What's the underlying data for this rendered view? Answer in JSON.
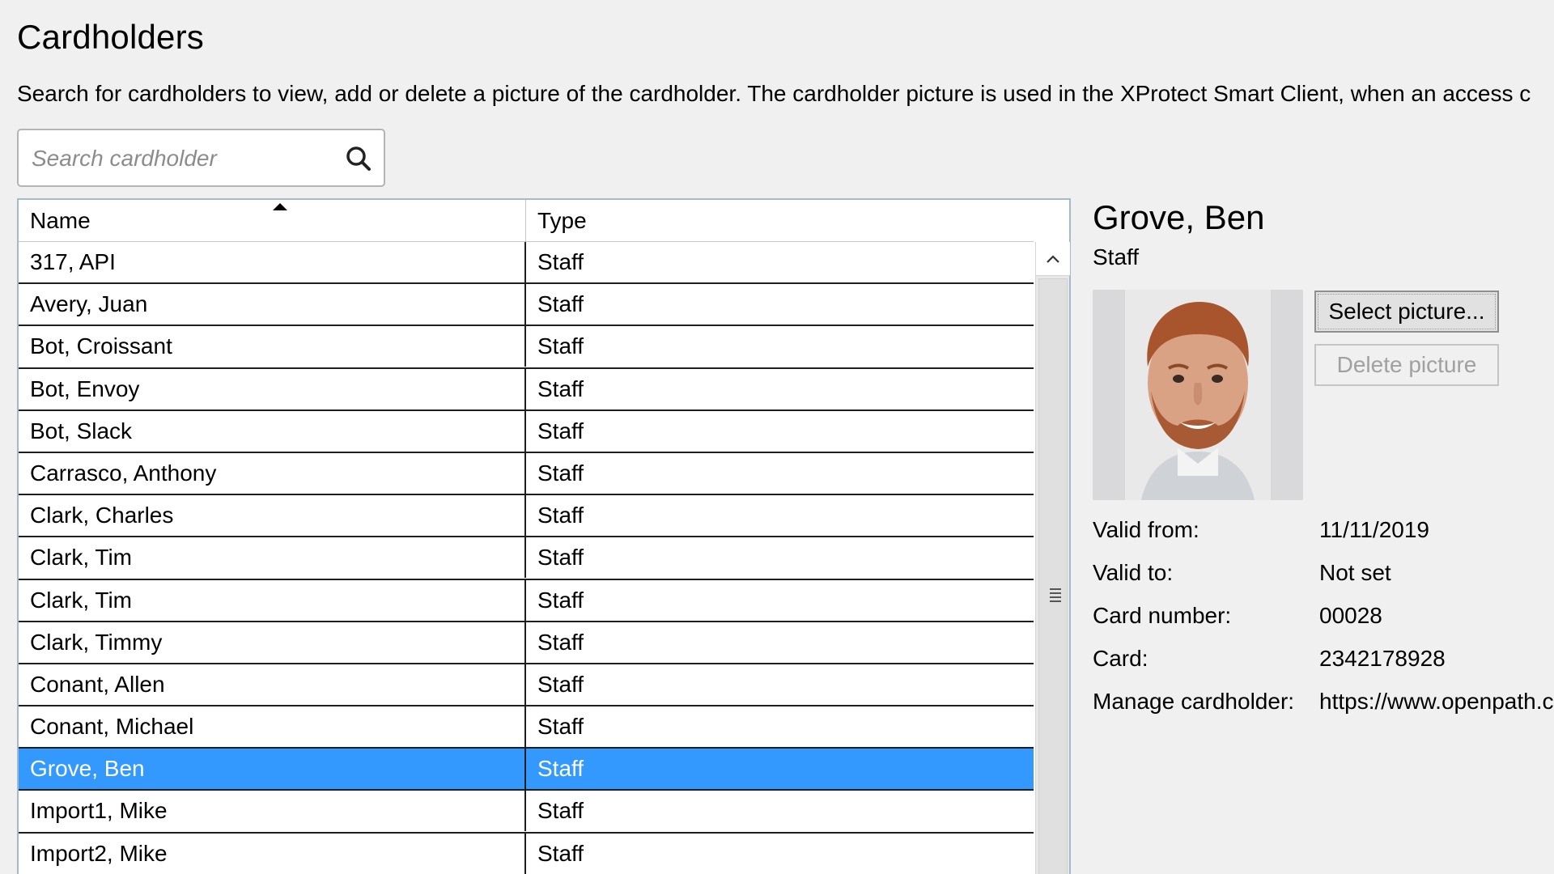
{
  "page": {
    "title": "Cardholders",
    "description": "Search for cardholders to view, add or delete a picture of the cardholder. The cardholder picture is used in the XProtect Smart Client, when an access c"
  },
  "search": {
    "placeholder": "Search cardholder",
    "value": "",
    "icon": "search-icon"
  },
  "table": {
    "columns": [
      "Name",
      "Type"
    ],
    "sort": {
      "column": "Name",
      "direction": "ascending"
    },
    "rows": [
      {
        "name": "317, API",
        "type": "Staff",
        "selected": false
      },
      {
        "name": "Avery, Juan",
        "type": "Staff",
        "selected": false
      },
      {
        "name": "Bot, Croissant",
        "type": "Staff",
        "selected": false
      },
      {
        "name": "Bot, Envoy",
        "type": "Staff",
        "selected": false
      },
      {
        "name": "Bot, Slack",
        "type": "Staff",
        "selected": false
      },
      {
        "name": "Carrasco, Anthony",
        "type": "Staff",
        "selected": false
      },
      {
        "name": "Clark, Charles",
        "type": "Staff",
        "selected": false
      },
      {
        "name": "Clark, Tim",
        "type": "Staff",
        "selected": false
      },
      {
        "name": "Clark, Tim",
        "type": "Staff",
        "selected": false
      },
      {
        "name": "Clark, Timmy",
        "type": "Staff",
        "selected": false
      },
      {
        "name": "Conant, Allen",
        "type": "Staff",
        "selected": false
      },
      {
        "name": "Conant, Michael",
        "type": "Staff",
        "selected": false
      },
      {
        "name": "Grove, Ben",
        "type": "Staff",
        "selected": true
      },
      {
        "name": "Import1, Mike",
        "type": "Staff",
        "selected": false
      },
      {
        "name": "Import2, Mike",
        "type": "Staff",
        "selected": false
      }
    ],
    "selected_color": "#3399ff"
  },
  "detail": {
    "name": "Grove, Ben",
    "type": "Staff",
    "select_picture_label": "Select picture...",
    "delete_picture_label": "Delete picture",
    "fields": [
      {
        "label": "Valid from:",
        "value": "11/11/2019"
      },
      {
        "label": "Valid to:",
        "value": "Not set"
      },
      {
        "label": "Card number:",
        "value": "00028"
      },
      {
        "label": "Card:",
        "value": "2342178928"
      },
      {
        "label": "Manage cardholder:",
        "value": "https://www.openpath.c"
      }
    ]
  }
}
